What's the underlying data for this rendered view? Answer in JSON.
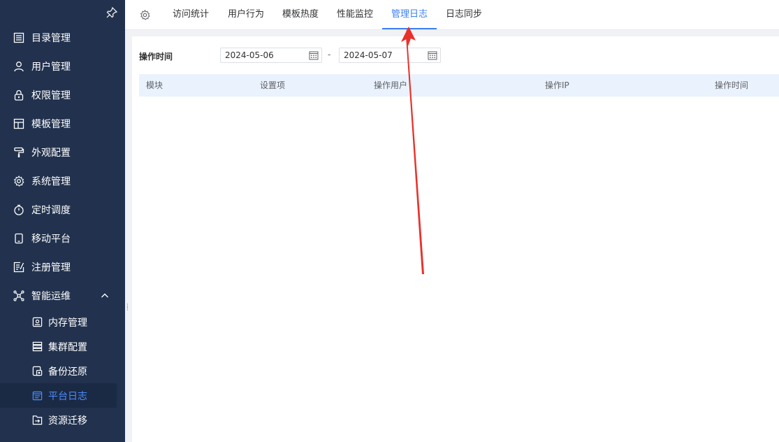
{
  "sidebar": {
    "items": [
      {
        "label": "目录管理",
        "icon": "list-icon"
      },
      {
        "label": "用户管理",
        "icon": "user-icon"
      },
      {
        "label": "权限管理",
        "icon": "lock-icon"
      },
      {
        "label": "模板管理",
        "icon": "template-icon"
      },
      {
        "label": "外观配置",
        "icon": "paint-roller-icon"
      },
      {
        "label": "系统管理",
        "icon": "gear-icon"
      },
      {
        "label": "定时调度",
        "icon": "timer-icon"
      },
      {
        "label": "移动平台",
        "icon": "mobile-icon"
      },
      {
        "label": "注册管理",
        "icon": "register-icon"
      },
      {
        "label": "智能运维",
        "icon": "network-icon"
      }
    ],
    "subitems": [
      {
        "label": "内存管理",
        "icon": "memory-icon"
      },
      {
        "label": "集群配置",
        "icon": "server-icon"
      },
      {
        "label": "备份还原",
        "icon": "backup-icon"
      },
      {
        "label": "平台日志",
        "icon": "log-icon",
        "active": true
      },
      {
        "label": "资源迁移",
        "icon": "migrate-icon"
      }
    ]
  },
  "tabs": [
    {
      "label": "访问统计"
    },
    {
      "label": "用户行为"
    },
    {
      "label": "模板热度"
    },
    {
      "label": "性能监控"
    },
    {
      "label": "管理日志",
      "active": true
    },
    {
      "label": "日志同步"
    }
  ],
  "filter": {
    "label": "操作时间",
    "start_date": "2024-05-06",
    "separator": "-",
    "end_date": "2024-05-07"
  },
  "table": {
    "columns": [
      "模块",
      "设置项",
      "操作用户",
      "操作IP",
      "操作时间"
    ]
  },
  "colors": {
    "sidebar_bg": "#22324e",
    "accent": "#3a7ff6",
    "annotation_arrow": "#e8312a"
  }
}
